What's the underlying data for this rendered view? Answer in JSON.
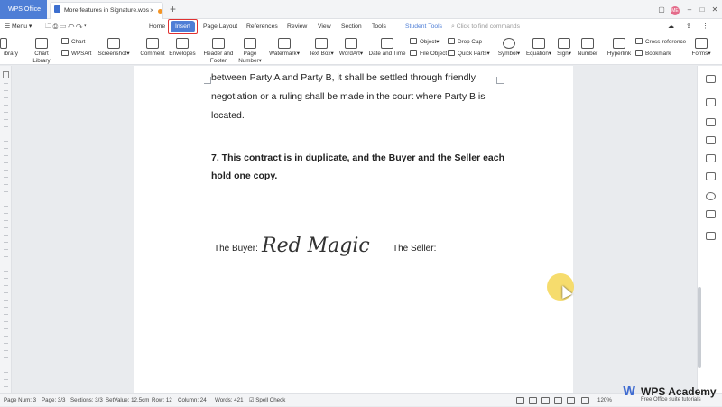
{
  "titlebar": {
    "app_tab": "WPS Office",
    "doc_tab": "More features in Signature.wps",
    "doc_close": "×",
    "new_tab": "+",
    "avatar": "ME"
  },
  "menu": {
    "menu_label": "Menu",
    "items": [
      "Home",
      "Insert",
      "Page Layout",
      "References",
      "Review",
      "View",
      "Section",
      "Tools",
      "Student Tools"
    ],
    "active": "Insert",
    "search_placeholder": "Click to find commands"
  },
  "ribbon": {
    "library": "ibrary",
    "chart_library": "Chart Library",
    "chart": "Chart",
    "wpsart": "WPSArt",
    "screenshot": "Screenshot",
    "comment": "Comment",
    "envelopes": "Envelopes",
    "header_footer": [
      "Header and",
      "Footer"
    ],
    "page_number": [
      "Page",
      "Number"
    ],
    "watermark": "Watermark",
    "text_box": "Text Box",
    "wordart": "WordArt",
    "date_time": "Date and Time",
    "object": "Object",
    "file_object": "File Object",
    "drop_cap": "Drop Cap",
    "quick_parts": "Quick Parts",
    "symbol": "Symbol",
    "equation": "Equation",
    "sign": "Sign",
    "number": "Number",
    "hyperlink": "Hyperlink",
    "cross_reference": "Cross-reference",
    "bookmark": "Bookmark",
    "forms": "Forms"
  },
  "document": {
    "para1_line1": "between Party A and Party B, it shall be settled through friendly",
    "para1_line2": "negotiation or a ruling shall be made in the court where Party B is",
    "para1_line3": "located.",
    "clause7_line1": "7. This contract is in duplicate, and the Buyer and the Seller  each",
    "clause7_line2": "hold one copy.",
    "buyer_label": "The Buyer:",
    "signature": "Red Magic",
    "seller_label": "The Seller:"
  },
  "status": {
    "page_num": "Page Num: 3",
    "page": "Page: 3/3",
    "sections": "Sections: 3/3",
    "setvalue": "SetValue: 12.5cm",
    "row": "Row: 12",
    "column": "Column: 24",
    "words": "Words: 421",
    "spell_check": "Spell Check",
    "zoom": "120%"
  },
  "watermark": {
    "name": "WPS Academy",
    "sub": "Free Office suite tutorials"
  },
  "colors": {
    "accent": "#4e7ed6",
    "highlight_box": "#e03131",
    "cursor_highlight": "#f4d654"
  }
}
